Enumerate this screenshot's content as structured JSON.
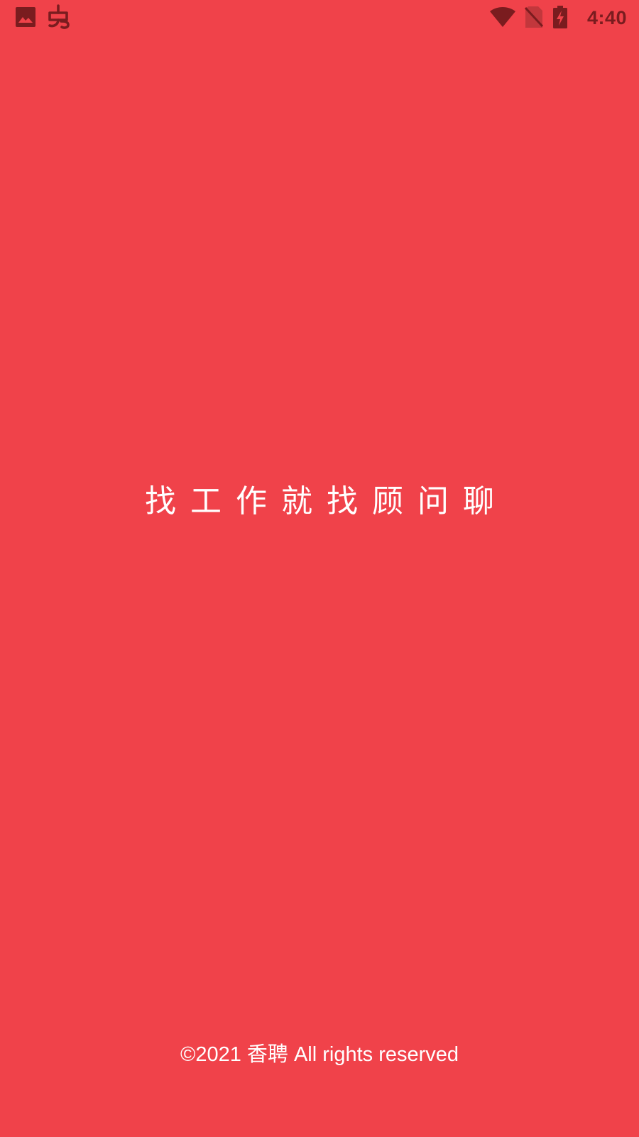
{
  "colors": {
    "background": "#F0424A",
    "status_icon": "#7A1C1F",
    "status_icon_dim": "#C2373C",
    "text": "#FFFFFF"
  },
  "status_bar": {
    "left_icons": [
      "image-icon",
      "bug-icon"
    ],
    "right_icons": [
      "wifi-icon",
      "no-sim-icon",
      "battery-charging-icon"
    ],
    "time": "4:40"
  },
  "splash": {
    "slogan": "找工作就找顾问聊",
    "copyright": "©2021 香聘 All rights reserved"
  }
}
